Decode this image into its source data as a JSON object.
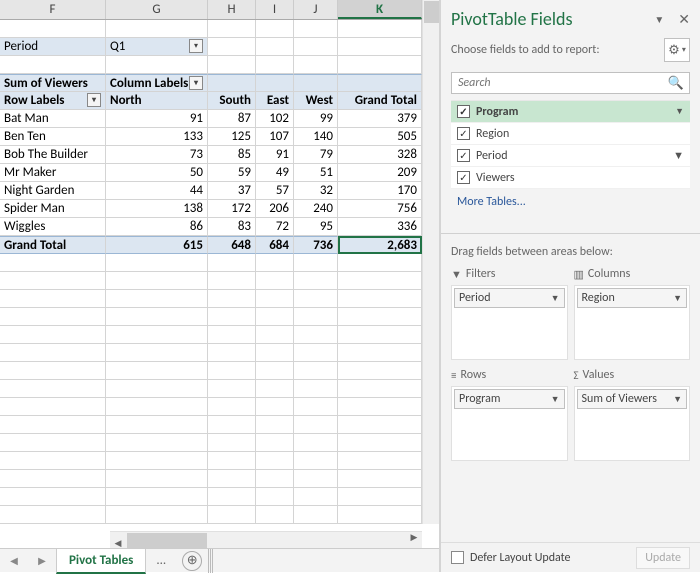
{
  "columns": [
    "F",
    "G",
    "H",
    "I",
    "J",
    "K"
  ],
  "filter_row": {
    "label": "Period",
    "value": "Q1"
  },
  "pivot_header": {
    "measure": "Sum of Viewers",
    "col_label": "Column Labels"
  },
  "row_label_header": "Row Labels",
  "col_headers": [
    "North",
    "South",
    "East",
    "West",
    "Grand Total"
  ],
  "rows": [
    {
      "label": "Bat Man",
      "v": [
        "91",
        "87",
        "102",
        "99",
        "379"
      ]
    },
    {
      "label": "Ben Ten",
      "v": [
        "133",
        "125",
        "107",
        "140",
        "505"
      ]
    },
    {
      "label": "Bob The Builder",
      "v": [
        "73",
        "85",
        "91",
        "79",
        "328"
      ]
    },
    {
      "label": "Mr Maker",
      "v": [
        "50",
        "59",
        "49",
        "51",
        "209"
      ]
    },
    {
      "label": "Night Garden",
      "v": [
        "44",
        "37",
        "57",
        "32",
        "170"
      ]
    },
    {
      "label": "Spider Man",
      "v": [
        "138",
        "172",
        "206",
        "240",
        "756"
      ]
    },
    {
      "label": "Wiggles",
      "v": [
        "86",
        "83",
        "72",
        "95",
        "336"
      ]
    }
  ],
  "grand_total": {
    "label": "Grand Total",
    "v": [
      "615",
      "648",
      "684",
      "736",
      "2,683"
    ]
  },
  "sheet_tab": "Pivot Tables",
  "tab_dots": "...",
  "pane": {
    "title": "PivotTable Fields",
    "subtitle": "Choose fields to add to report:",
    "search_placeholder": "Search",
    "fields": [
      "Program",
      "Region",
      "Period",
      "Viewers"
    ],
    "more": "More Tables...",
    "drag_label": "Drag fields between areas below:",
    "areas": {
      "filters": {
        "title": "Filters",
        "chip": "Period"
      },
      "columns": {
        "title": "Columns",
        "chip": "Region"
      },
      "rows": {
        "title": "Rows",
        "chip": "Program"
      },
      "values": {
        "title": "Values",
        "chip": "Sum of Viewers"
      }
    },
    "defer": "Defer Layout Update",
    "update": "Update"
  },
  "chart_data": {
    "type": "table",
    "title": "Sum of Viewers by Program and Region (Period = Q1)",
    "columns": [
      "Program",
      "North",
      "South",
      "East",
      "West",
      "Grand Total"
    ],
    "rows": [
      [
        "Bat Man",
        91,
        87,
        102,
        99,
        379
      ],
      [
        "Ben Ten",
        133,
        125,
        107,
        140,
        505
      ],
      [
        "Bob The Builder",
        73,
        85,
        91,
        79,
        328
      ],
      [
        "Mr Maker",
        50,
        59,
        49,
        51,
        209
      ],
      [
        "Night Garden",
        44,
        37,
        57,
        32,
        170
      ],
      [
        "Spider Man",
        138,
        172,
        206,
        240,
        756
      ],
      [
        "Wiggles",
        86,
        83,
        72,
        95,
        336
      ],
      [
        "Grand Total",
        615,
        648,
        684,
        736,
        2683
      ]
    ]
  }
}
